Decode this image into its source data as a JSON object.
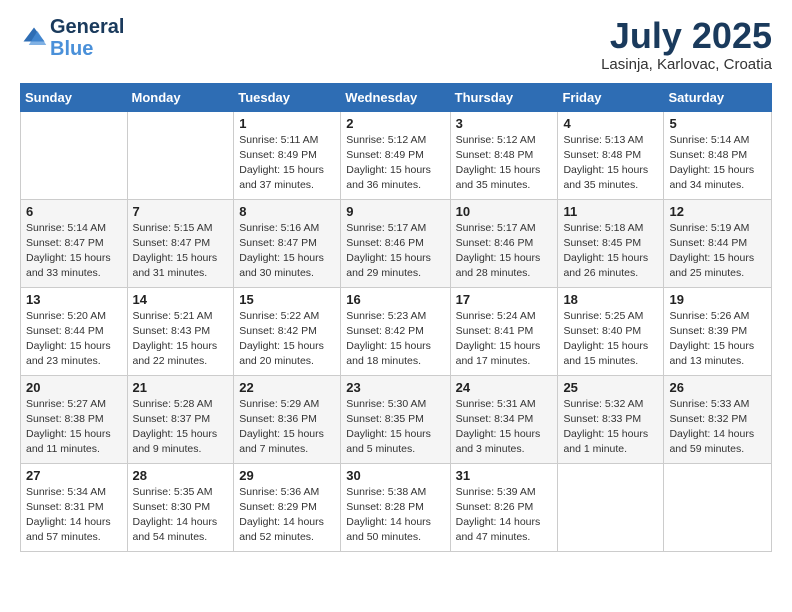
{
  "header": {
    "logo_line1": "General",
    "logo_line2": "Blue",
    "month_title": "July 2025",
    "location": "Lasinja, Karlovac, Croatia"
  },
  "days_of_week": [
    "Sunday",
    "Monday",
    "Tuesday",
    "Wednesday",
    "Thursday",
    "Friday",
    "Saturday"
  ],
  "weeks": [
    [
      {
        "day": "",
        "info": ""
      },
      {
        "day": "",
        "info": ""
      },
      {
        "day": "1",
        "info": "Sunrise: 5:11 AM\nSunset: 8:49 PM\nDaylight: 15 hours\nand 37 minutes."
      },
      {
        "day": "2",
        "info": "Sunrise: 5:12 AM\nSunset: 8:49 PM\nDaylight: 15 hours\nand 36 minutes."
      },
      {
        "day": "3",
        "info": "Sunrise: 5:12 AM\nSunset: 8:48 PM\nDaylight: 15 hours\nand 35 minutes."
      },
      {
        "day": "4",
        "info": "Sunrise: 5:13 AM\nSunset: 8:48 PM\nDaylight: 15 hours\nand 35 minutes."
      },
      {
        "day": "5",
        "info": "Sunrise: 5:14 AM\nSunset: 8:48 PM\nDaylight: 15 hours\nand 34 minutes."
      }
    ],
    [
      {
        "day": "6",
        "info": "Sunrise: 5:14 AM\nSunset: 8:47 PM\nDaylight: 15 hours\nand 33 minutes."
      },
      {
        "day": "7",
        "info": "Sunrise: 5:15 AM\nSunset: 8:47 PM\nDaylight: 15 hours\nand 31 minutes."
      },
      {
        "day": "8",
        "info": "Sunrise: 5:16 AM\nSunset: 8:47 PM\nDaylight: 15 hours\nand 30 minutes."
      },
      {
        "day": "9",
        "info": "Sunrise: 5:17 AM\nSunset: 8:46 PM\nDaylight: 15 hours\nand 29 minutes."
      },
      {
        "day": "10",
        "info": "Sunrise: 5:17 AM\nSunset: 8:46 PM\nDaylight: 15 hours\nand 28 minutes."
      },
      {
        "day": "11",
        "info": "Sunrise: 5:18 AM\nSunset: 8:45 PM\nDaylight: 15 hours\nand 26 minutes."
      },
      {
        "day": "12",
        "info": "Sunrise: 5:19 AM\nSunset: 8:44 PM\nDaylight: 15 hours\nand 25 minutes."
      }
    ],
    [
      {
        "day": "13",
        "info": "Sunrise: 5:20 AM\nSunset: 8:44 PM\nDaylight: 15 hours\nand 23 minutes."
      },
      {
        "day": "14",
        "info": "Sunrise: 5:21 AM\nSunset: 8:43 PM\nDaylight: 15 hours\nand 22 minutes."
      },
      {
        "day": "15",
        "info": "Sunrise: 5:22 AM\nSunset: 8:42 PM\nDaylight: 15 hours\nand 20 minutes."
      },
      {
        "day": "16",
        "info": "Sunrise: 5:23 AM\nSunset: 8:42 PM\nDaylight: 15 hours\nand 18 minutes."
      },
      {
        "day": "17",
        "info": "Sunrise: 5:24 AM\nSunset: 8:41 PM\nDaylight: 15 hours\nand 17 minutes."
      },
      {
        "day": "18",
        "info": "Sunrise: 5:25 AM\nSunset: 8:40 PM\nDaylight: 15 hours\nand 15 minutes."
      },
      {
        "day": "19",
        "info": "Sunrise: 5:26 AM\nSunset: 8:39 PM\nDaylight: 15 hours\nand 13 minutes."
      }
    ],
    [
      {
        "day": "20",
        "info": "Sunrise: 5:27 AM\nSunset: 8:38 PM\nDaylight: 15 hours\nand 11 minutes."
      },
      {
        "day": "21",
        "info": "Sunrise: 5:28 AM\nSunset: 8:37 PM\nDaylight: 15 hours\nand 9 minutes."
      },
      {
        "day": "22",
        "info": "Sunrise: 5:29 AM\nSunset: 8:36 PM\nDaylight: 15 hours\nand 7 minutes."
      },
      {
        "day": "23",
        "info": "Sunrise: 5:30 AM\nSunset: 8:35 PM\nDaylight: 15 hours\nand 5 minutes."
      },
      {
        "day": "24",
        "info": "Sunrise: 5:31 AM\nSunset: 8:34 PM\nDaylight: 15 hours\nand 3 minutes."
      },
      {
        "day": "25",
        "info": "Sunrise: 5:32 AM\nSunset: 8:33 PM\nDaylight: 15 hours\nand 1 minute."
      },
      {
        "day": "26",
        "info": "Sunrise: 5:33 AM\nSunset: 8:32 PM\nDaylight: 14 hours\nand 59 minutes."
      }
    ],
    [
      {
        "day": "27",
        "info": "Sunrise: 5:34 AM\nSunset: 8:31 PM\nDaylight: 14 hours\nand 57 minutes."
      },
      {
        "day": "28",
        "info": "Sunrise: 5:35 AM\nSunset: 8:30 PM\nDaylight: 14 hours\nand 54 minutes."
      },
      {
        "day": "29",
        "info": "Sunrise: 5:36 AM\nSunset: 8:29 PM\nDaylight: 14 hours\nand 52 minutes."
      },
      {
        "day": "30",
        "info": "Sunrise: 5:38 AM\nSunset: 8:28 PM\nDaylight: 14 hours\nand 50 minutes."
      },
      {
        "day": "31",
        "info": "Sunrise: 5:39 AM\nSunset: 8:26 PM\nDaylight: 14 hours\nand 47 minutes."
      },
      {
        "day": "",
        "info": ""
      },
      {
        "day": "",
        "info": ""
      }
    ]
  ]
}
